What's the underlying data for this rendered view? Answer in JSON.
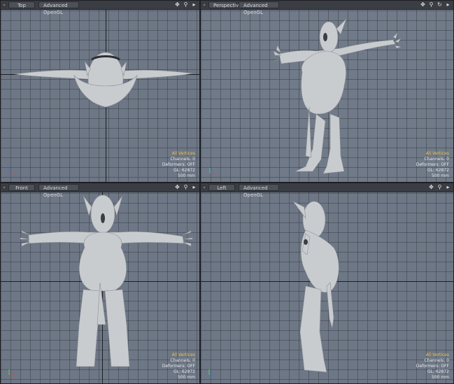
{
  "viewports": [
    {
      "view_label": "Top",
      "mode_label": "Advanced OpenGL",
      "selection": "All Vertices",
      "channels": "Channels: 0",
      "deformers": "Deformers: OFF",
      "gl": "GL: 62872",
      "scale": "500 mm"
    },
    {
      "view_label": "Perspective",
      "mode_label": "Advanced OpenGL",
      "selection": "All Vertices",
      "channels": "Channels: 0",
      "deformers": "Deformers: OFF",
      "gl": "GL: 62872",
      "scale": "500 mm"
    },
    {
      "view_label": "Front",
      "mode_label": "Advanced OpenGL",
      "selection": "All Vertices",
      "channels": "Channels: 0",
      "deformers": "Deformers: OFF",
      "gl": "GL: 62872",
      "scale": "500 mm"
    },
    {
      "view_label": "Left",
      "mode_label": "Advanced OpenGL",
      "selection": "All Vertices",
      "channels": "Channels: 0",
      "deformers": "Deformers: OFF",
      "gl": "GL: 62872",
      "scale": "500 mm"
    }
  ],
  "icons": [
    "move-icon",
    "zoom-icon",
    "rotate-icon",
    "menu-arrow-icon"
  ],
  "colors": {
    "viewport_bg": "#6e7785",
    "selection_text": "#f2c244",
    "stats_text": "#e8eaee",
    "mesh": "#c9cccf"
  }
}
